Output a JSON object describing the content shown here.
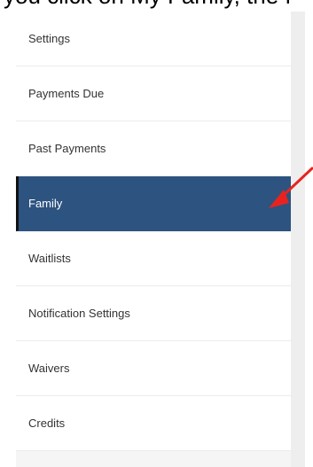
{
  "header": {
    "partial_text": "you click on My Family, the f"
  },
  "menu": {
    "items": [
      {
        "label": "Settings"
      },
      {
        "label": "Payments Due"
      },
      {
        "label": "Past Payments"
      },
      {
        "label": "Family"
      },
      {
        "label": "Waitlists"
      },
      {
        "label": "Notification Settings"
      },
      {
        "label": "Waivers"
      },
      {
        "label": "Credits"
      }
    ],
    "active_index": 3
  },
  "colors": {
    "active_bg": "#2d5380",
    "active_text": "#ffffff",
    "item_text": "#333333",
    "annotation_arrow": "#e8231f"
  },
  "annotation": {
    "icon": "red-arrow-icon"
  }
}
